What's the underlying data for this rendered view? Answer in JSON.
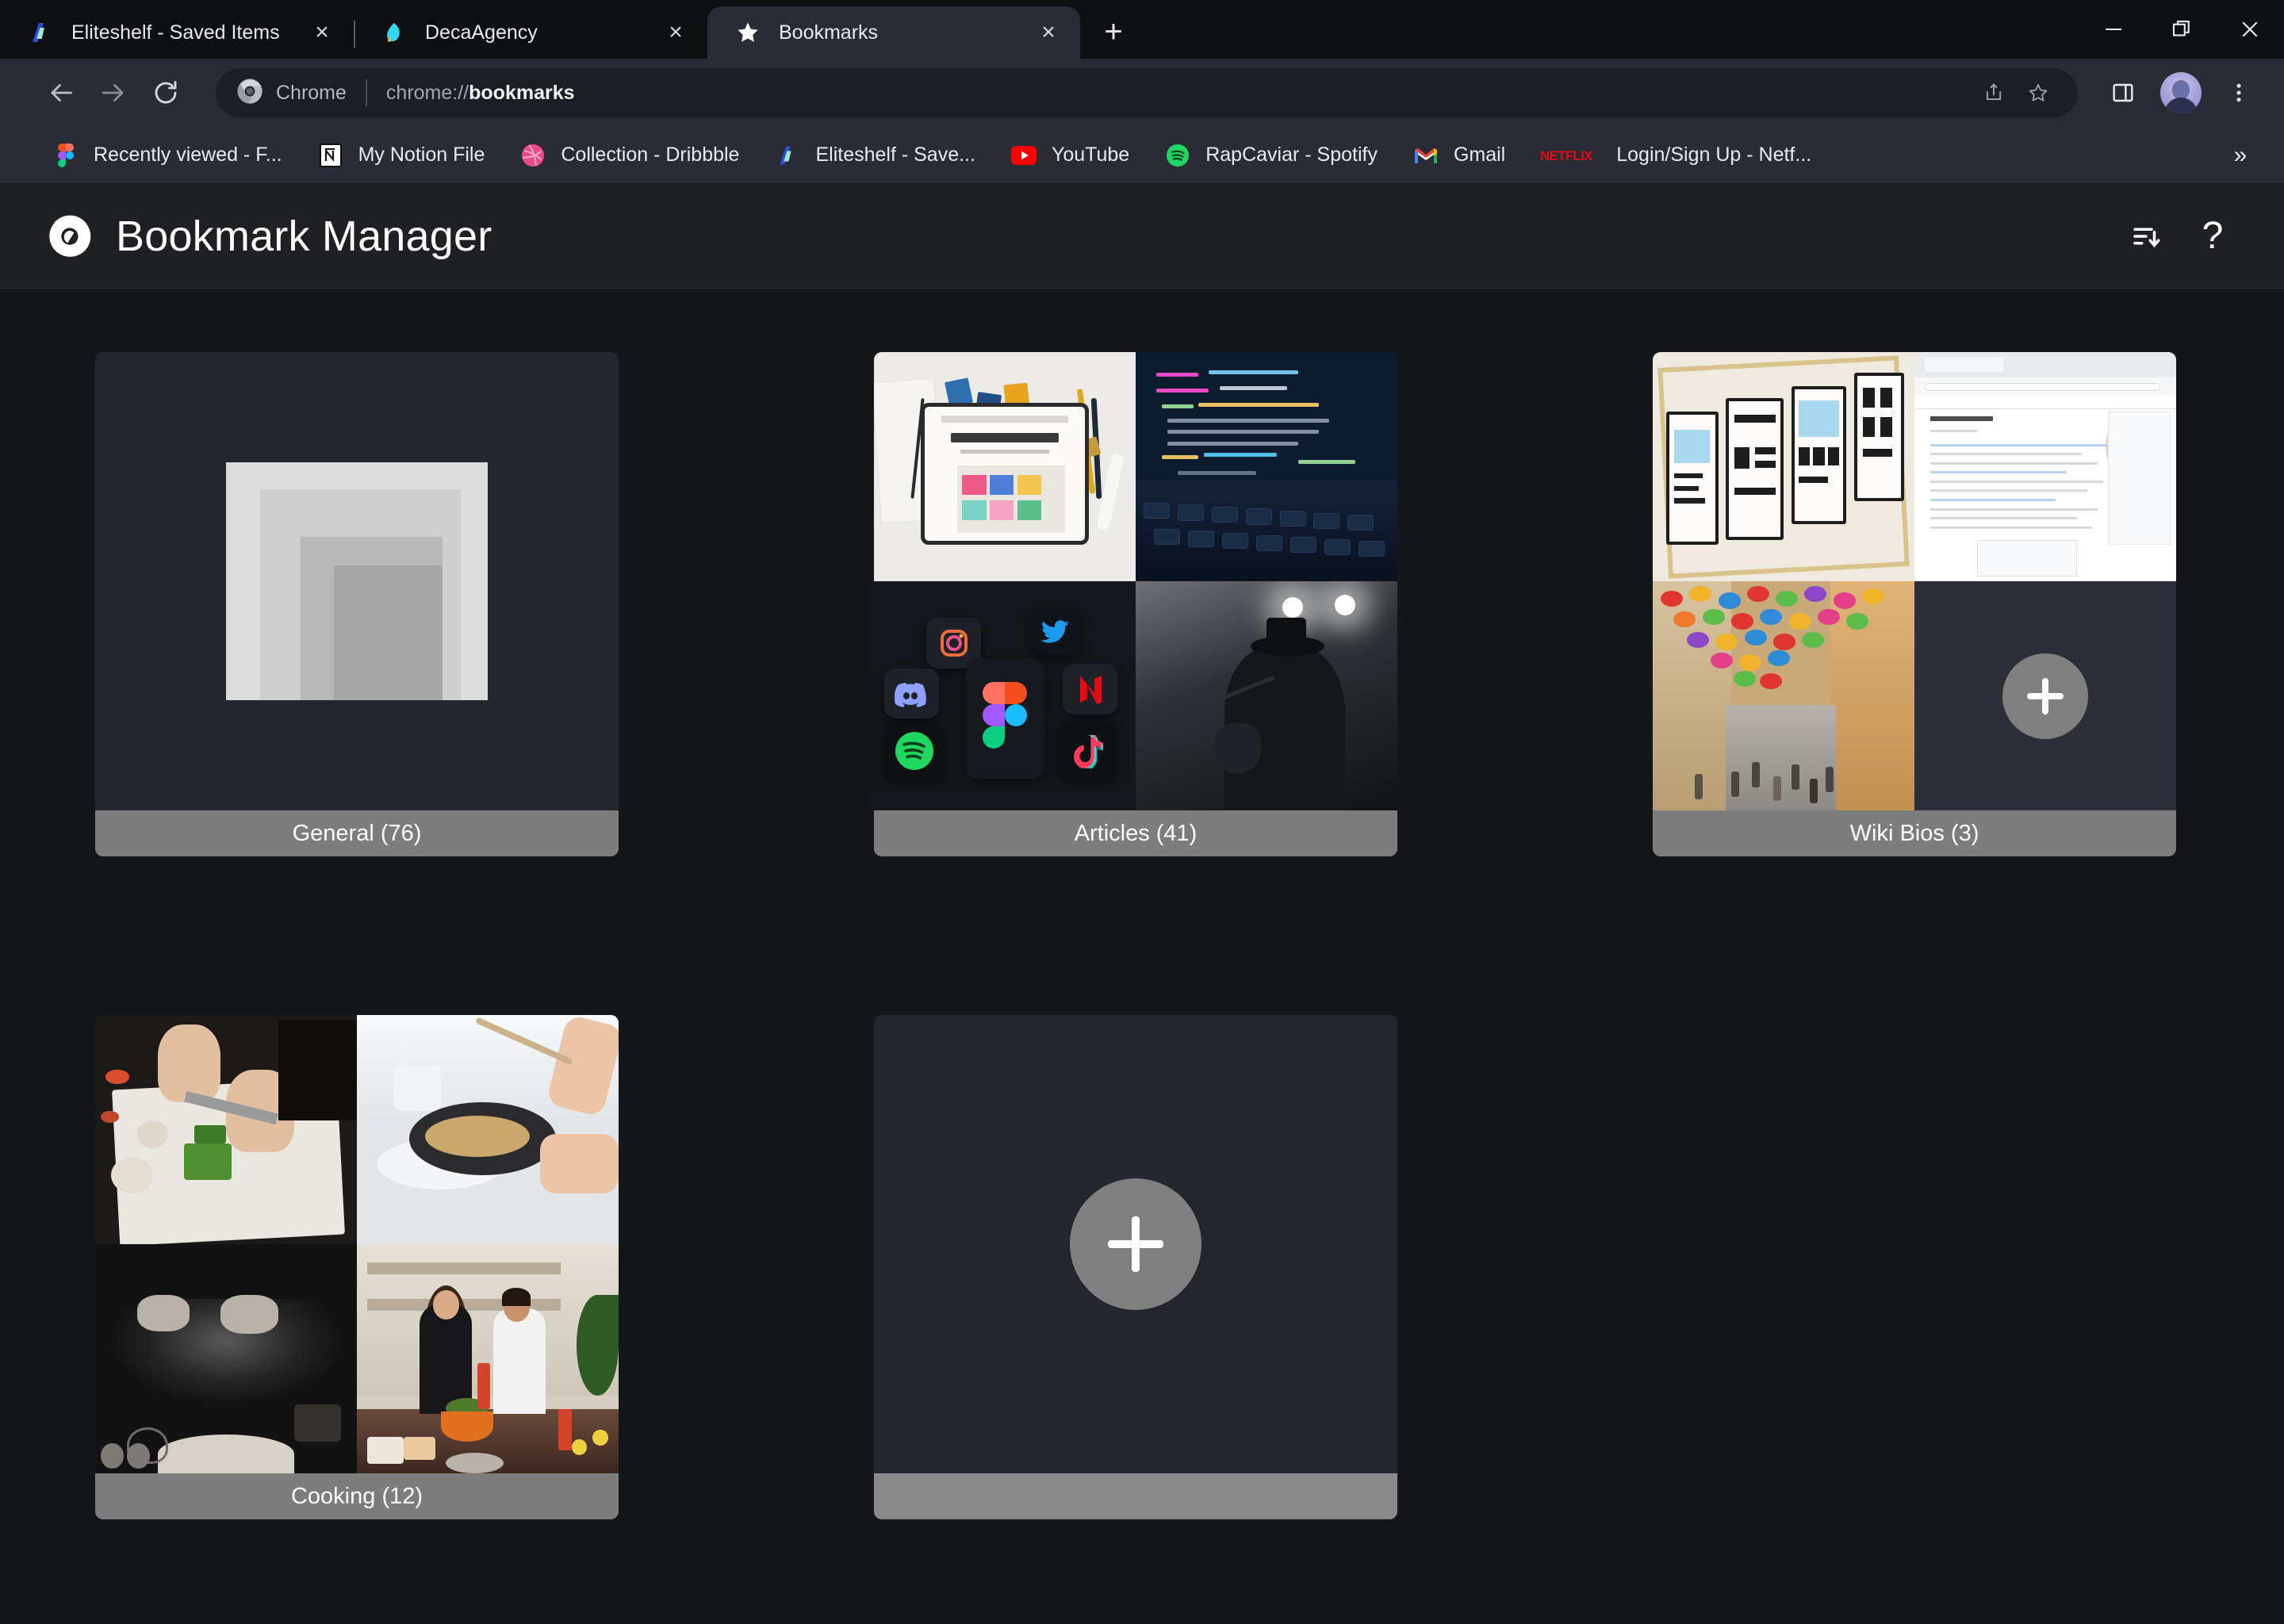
{
  "window": {
    "minimize_label": "Minimize",
    "maximize_label": "Restore",
    "close_label": "Close"
  },
  "tabs": [
    {
      "title": "Eliteshelf - Saved Items",
      "icon": "eliteshelf-icon",
      "active": false,
      "close_label": "×"
    },
    {
      "title": "DecaAgency",
      "icon": "decaagency-icon",
      "active": false,
      "close_label": "×"
    },
    {
      "title": "Bookmarks",
      "icon": "star-icon",
      "active": true,
      "close_label": "×"
    }
  ],
  "new_tab_label": "+",
  "toolbar": {
    "back_label": "Back",
    "forward_label": "Forward",
    "reload_label": "Reload",
    "chip_label": "Chrome",
    "url_prefix": "chrome://",
    "url_bold": "bookmarks",
    "url_full": "chrome://bookmarks",
    "share_label": "Share",
    "bookmark_star_label": "Bookmark this tab",
    "side_panel_label": "Side panel",
    "profile_label": "Profile",
    "menu_label": "Customize and control Google Chrome"
  },
  "bookmarks_bar": {
    "items": [
      {
        "label": "Recently viewed - F...",
        "icon": "figma-icon"
      },
      {
        "label": "My Notion File",
        "icon": "notion-icon"
      },
      {
        "label": "Collection - Dribbble",
        "icon": "dribbble-icon"
      },
      {
        "label": "Eliteshelf - Save...",
        "icon": "eliteshelf-icon"
      },
      {
        "label": "YouTube",
        "icon": "youtube-icon"
      },
      {
        "label": "RapCaviar - Spotify",
        "icon": "spotify-icon"
      },
      {
        "label": "Gmail",
        "icon": "gmail-icon"
      },
      {
        "label": "Login/Sign Up - Netf...",
        "icon": "netflix-icon"
      }
    ],
    "overflow_label": "»"
  },
  "bookmark_manager": {
    "logo": "chrome-icon",
    "title": "Bookmark Manager",
    "sort_label": "Sort",
    "help_label": "?"
  },
  "folders": [
    {
      "name": "General",
      "count": 76,
      "label": "General (76)",
      "kind": "placeholder",
      "thumbnails": []
    },
    {
      "name": "Articles",
      "count": 41,
      "label": "Articles (41)",
      "kind": "quad",
      "thumbnails": [
        "mailchimp-tablet-photo",
        "code-editor-photo",
        "app-icons-3d-photo",
        "guitarist-stage-photo"
      ]
    },
    {
      "name": "Wiki Bios",
      "count": 3,
      "label": "Wiki Bios (3)",
      "kind": "quad",
      "thumbnails": [
        "wireframe-sketch-photo",
        "wikipedia-page-screenshot",
        "umbrella-street-photo",
        "add-bookmark-tile"
      ]
    },
    {
      "name": "Cooking",
      "count": 12,
      "label": "Cooking (12)",
      "kind": "quad",
      "thumbnails": [
        "chopping-vegetables-photo",
        "pan-frying-photo",
        "flour-dusting-photo",
        "couple-cooking-photo"
      ]
    },
    {
      "name": "",
      "count": null,
      "label": "",
      "kind": "add",
      "thumbnails": []
    }
  ],
  "colors": {
    "page_background": "#141619",
    "card_background": "#24262e",
    "card_label_background": "#7d7d7d",
    "toolbar_background": "#292c35",
    "tabstrip_background": "#0e0f11",
    "header_background": "#1e2024",
    "accent_text": "#ffffff"
  }
}
